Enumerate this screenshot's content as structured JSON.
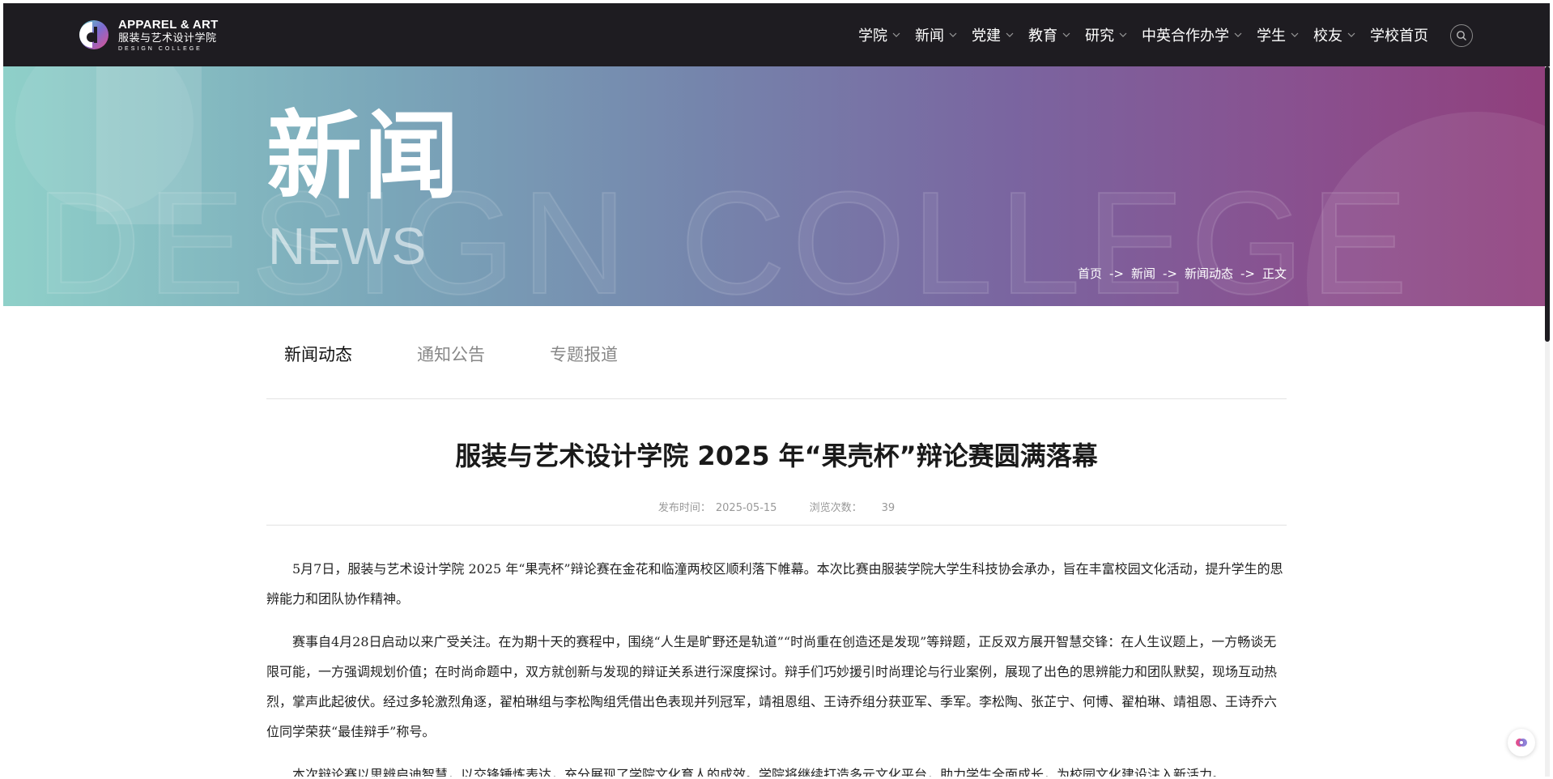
{
  "header": {
    "logo": {
      "en_line1": "APPAREL & ART",
      "cn_line": "服装与艺术设计学院",
      "en_line2": "DESIGN COLLEGE"
    },
    "nav": [
      {
        "label": "学院",
        "has_dropdown": true
      },
      {
        "label": "新闻",
        "has_dropdown": true
      },
      {
        "label": "党建",
        "has_dropdown": true
      },
      {
        "label": "教育",
        "has_dropdown": true
      },
      {
        "label": "研究",
        "has_dropdown": true
      },
      {
        "label": "中英合作办学",
        "has_dropdown": true
      },
      {
        "label": "学生",
        "has_dropdown": true
      },
      {
        "label": "校友",
        "has_dropdown": true
      },
      {
        "label": "学校首页",
        "has_dropdown": false
      }
    ],
    "search_icon": "search-icon"
  },
  "banner": {
    "title_cn": "新闻",
    "title_en": "NEWS",
    "watermark": "DESIGN COLLEGE"
  },
  "breadcrumb": {
    "items": [
      "首页",
      "新闻",
      "新闻动态",
      "正文"
    ],
    "separator": "->"
  },
  "tabs": [
    {
      "label": "新闻动态",
      "active": true
    },
    {
      "label": "通知公告",
      "active": false
    },
    {
      "label": "专题报道",
      "active": false
    }
  ],
  "article": {
    "title": "服装与艺术设计学院 2025 年“果壳杯”辩论赛圆满落幕",
    "publish_label": "发布时间：",
    "publish_date": "2025-05-15",
    "views_label": "浏览次数：",
    "views": "39",
    "paragraphs": [
      "5月7日，服装与艺术设计学院 2025 年“果壳杯”辩论赛在金花和临潼两校区顺利落下帷幕。本次比赛由服装学院大学生科技协会承办，旨在丰富校园文化活动，提升学生的思辨能力和团队协作精神。",
      "赛事自4月28日启动以来广受关注。在为期十天的赛程中，围绕“人生是旷野还是轨道”“时尚重在创造还是发现”等辩题，正反双方展开智慧交锋：在人生议题上，一方畅谈无限可能，一方强调规划价值；在时尚命题中，双方就创新与发现的辩证关系进行深度探讨。辩手们巧妙援引时尚理论与行业案例，展现了出色的思辨能力和团队默契，现场互动热烈，掌声此起彼伏。经过多轮激烈角逐，翟柏琳组与李松陶组凭借出色表现并列冠军，靖祖恩组、王诗乔组分获亚军、季军。李松陶、张芷宁、何博、翟柏琳、靖祖恩、王诗乔六位同学荣获“最佳辩手”称号。",
      "本次辩论赛以思辨启迪智慧，以交锋锤炼表达，充分展现了学院文化育人的成效。学院将继续打造多元文化平台，助力学生全面成长，为校园文化建设注入新活力。"
    ]
  },
  "colors": {
    "header_bg": "#1e1c21",
    "banner_start": "#8fd0c9",
    "banner_end": "#903f7c",
    "tab_active": "#111111",
    "tab_inactive": "#888888"
  }
}
